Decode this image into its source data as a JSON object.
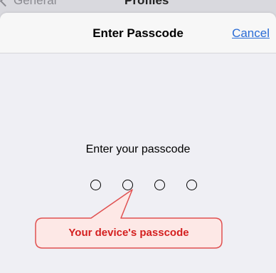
{
  "behind_nav": {
    "back_label": "General",
    "title": "Profiles"
  },
  "sheet": {
    "title": "Enter Passcode",
    "cancel_label": "Cancel",
    "prompt": "Enter your passcode",
    "digit_count": 4
  },
  "annotation": {
    "text": "Your device's passcode",
    "text_color": "#d41f1f",
    "fill_color": "#fde8e6",
    "border_color": "#e05050"
  },
  "colors": {
    "background": "#efeff4",
    "nav_background": "#f7f7f7",
    "link": "#2a6cd6"
  }
}
